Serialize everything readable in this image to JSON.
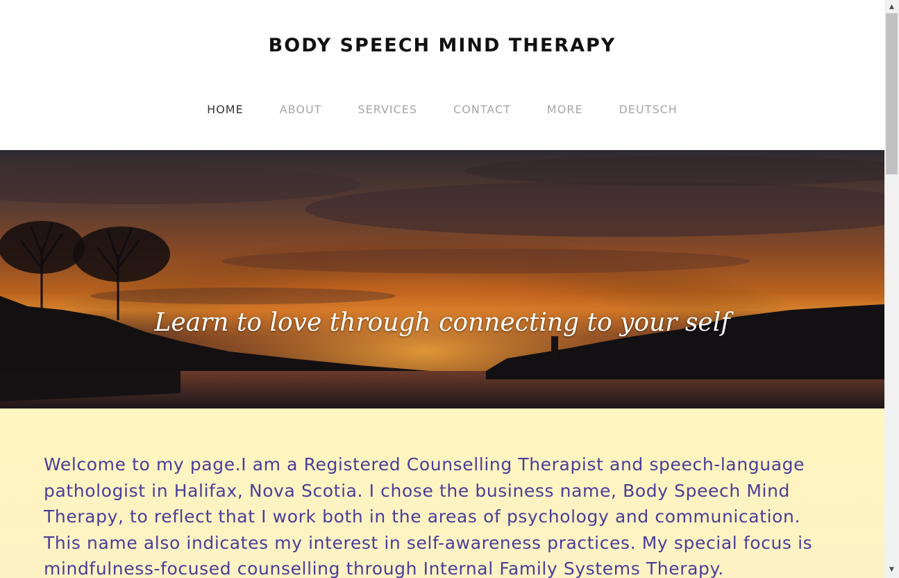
{
  "header": {
    "title": "BODY SPEECH MIND THERAPY"
  },
  "nav": {
    "items": [
      {
        "label": "HOME",
        "active": true
      },
      {
        "label": "ABOUT",
        "active": false
      },
      {
        "label": "SERVICES",
        "active": false
      },
      {
        "label": "CONTACT",
        "active": false
      },
      {
        "label": "MORE",
        "active": false
      },
      {
        "label": "DEUTSCH",
        "active": false
      }
    ]
  },
  "hero": {
    "tagline": "Learn to love through connecting to your self"
  },
  "intro": {
    "text": "Welcome to my page.I am a Registered Counselling Therapist and speech-language pathologist in Halifax, Nova Scotia. I chose the business name, Body Speech Mind Therapy, to reflect that I work both in the areas of psychology and communication. This name also indicates my interest in self-awareness practices. My special focus is mindfulness-focused counselling through  Internal Family Systems Therapy."
  },
  "colors": {
    "nav_active": "#333333",
    "nav_inactive": "#a6a6a6",
    "intro_background": "#fff5bf",
    "intro_text": "#4a3d9a"
  },
  "icons": {
    "scroll_up": "triangle-up-icon",
    "scroll_down": "triangle-down-icon"
  }
}
